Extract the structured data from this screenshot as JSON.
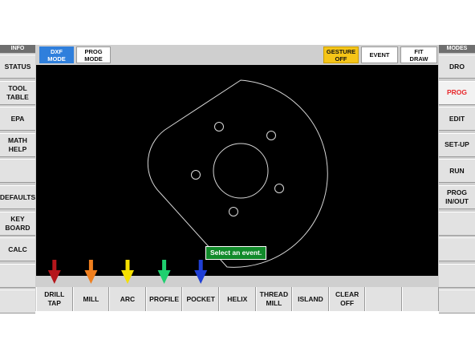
{
  "left_panel": {
    "header": "INFO",
    "items": [
      {
        "label": "STATUS"
      },
      {
        "label": "TOOL\nTABLE"
      },
      {
        "label": "EPA"
      },
      {
        "label": "MATH\nHELP"
      },
      {
        "label": ""
      },
      {
        "label": "DEFAULTS"
      },
      {
        "label": "KEY\nBOARD"
      },
      {
        "label": "CALC"
      },
      {
        "label": ""
      },
      {
        "label": ""
      }
    ]
  },
  "right_panel": {
    "header": "MODES",
    "items": [
      {
        "label": "DRO"
      },
      {
        "label": "PROG"
      },
      {
        "label": "EDIT"
      },
      {
        "label": "SET-UP"
      },
      {
        "label": "RUN"
      },
      {
        "label": "PROG\nIN/OUT"
      },
      {
        "label": ""
      },
      {
        "label": ""
      },
      {
        "label": ""
      },
      {
        "label": ""
      }
    ],
    "active_label": "PROG"
  },
  "top_bar": {
    "dxf_mode": "DXF\nMODE",
    "prog_mode": "PROG\nMODE",
    "gesture_off": "GESTURE\nOFF",
    "event": "EVENT",
    "fit_draw": "FIT\nDRAW"
  },
  "bottom_bar": {
    "items": [
      {
        "label": "DRILL\nTAP",
        "arrow_color": "#b5161b"
      },
      {
        "label": "MILL",
        "arrow_color": "#f07f1e"
      },
      {
        "label": "ARC",
        "arrow_color": "#f5e000"
      },
      {
        "label": "PROFILE",
        "arrow_color": "#1fcf6f"
      },
      {
        "label": "POCKET",
        "arrow_color": "#1f3fd6"
      },
      {
        "label": "HELIX"
      },
      {
        "label": "THREAD\nMILL"
      },
      {
        "label": "ISLAND"
      },
      {
        "label": "CLEAR\nOFF"
      },
      {
        "label": ""
      },
      {
        "label": ""
      }
    ]
  },
  "tooltip": "Select an event.",
  "colors": {
    "dxf_mode_bg": "#2f7fdc",
    "gesture_bg": "#f5c518",
    "active_mode_text": "#e8262a",
    "tooltip_bg": "#118a2a"
  }
}
